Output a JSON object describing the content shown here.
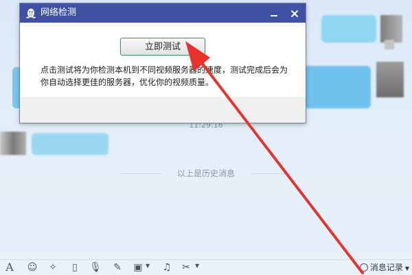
{
  "dialog": {
    "title": "网络检测",
    "test_button": "立即测试",
    "description": "点击测试将为你检测本机到不同视频服务器的速度，测试完成后会为你自动选择更佳的服务器，优化你的视频质量。"
  },
  "chat": {
    "timestamp": "11:29:16",
    "history_divider": "以上是历史消息"
  },
  "toolbar": {
    "items": [
      "font-icon",
      "emoji-icon",
      "magic-icon",
      "shake-icon",
      "voice-icon",
      "edit-icon",
      "image-icon",
      "music-icon",
      "scissors-icon"
    ],
    "history_label": "消息记录"
  },
  "colors": {
    "titlebar": "#3f51a3",
    "button_border": "#2e9a55",
    "arrow": "#e8322b"
  }
}
